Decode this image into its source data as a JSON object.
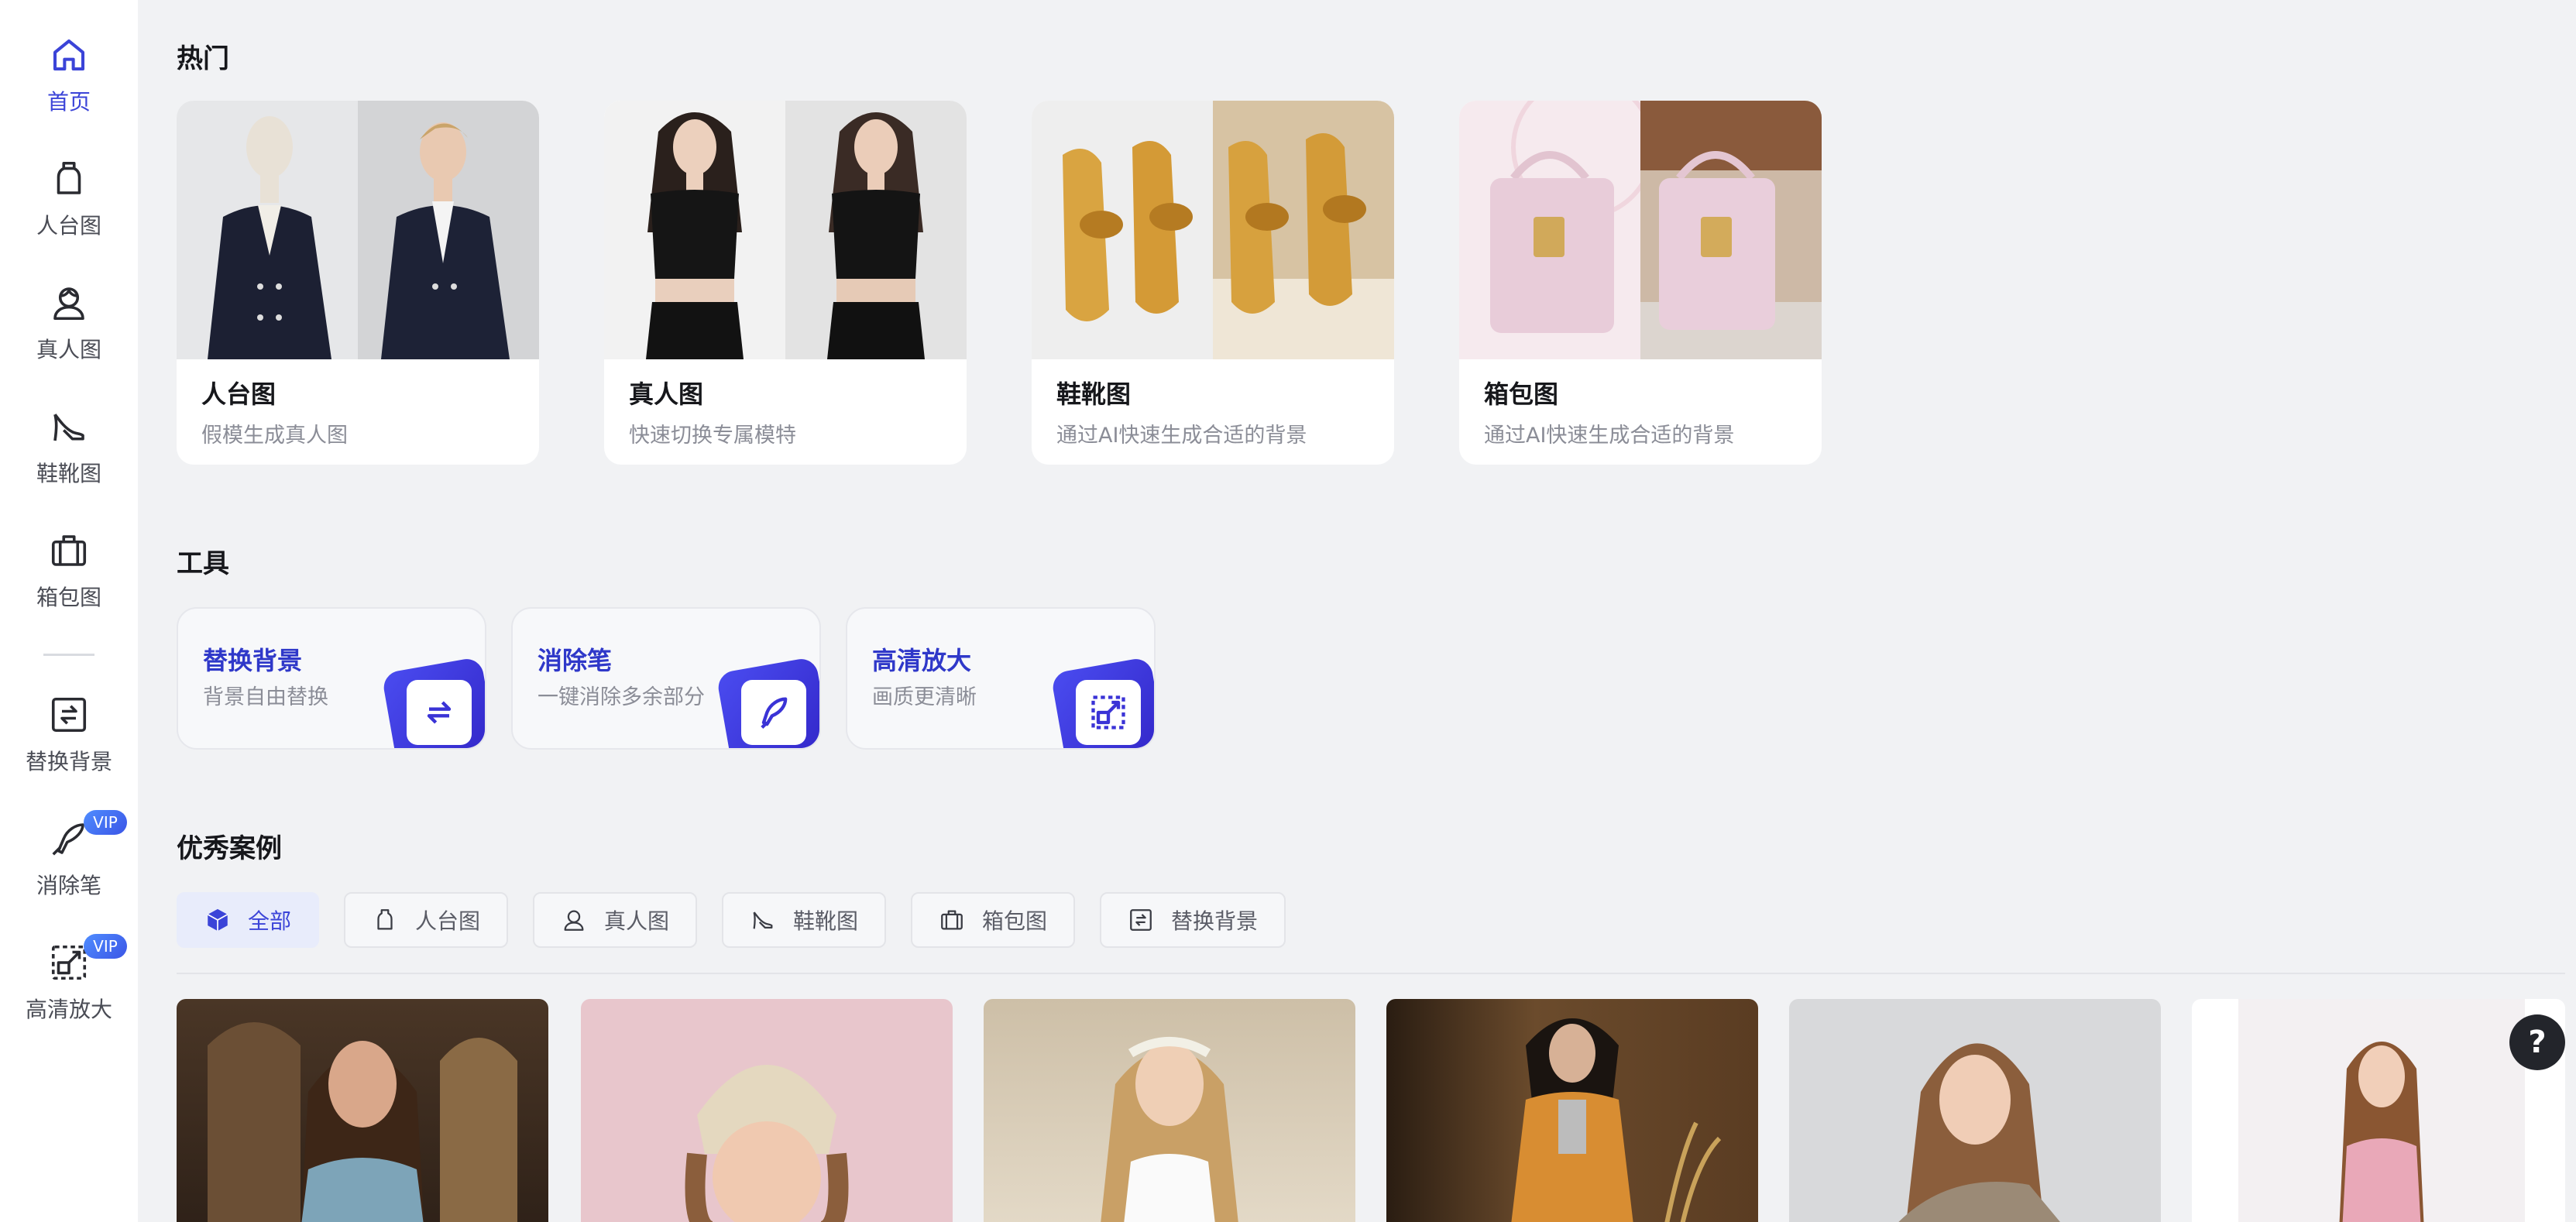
{
  "sidebar": {
    "items": [
      {
        "label": "首页",
        "icon": "home-icon"
      },
      {
        "label": "人台图",
        "icon": "mannequin-icon"
      },
      {
        "label": "真人图",
        "icon": "person-icon"
      },
      {
        "label": "鞋靴图",
        "icon": "high-heel-icon"
      },
      {
        "label": "箱包图",
        "icon": "bag-icon"
      },
      {
        "label": "替换背景",
        "icon": "replace-background-icon"
      },
      {
        "label": "消除笔",
        "icon": "eraser-pen-icon",
        "badge": "VIP"
      },
      {
        "label": "高清放大",
        "icon": "upscale-icon",
        "badge": "VIP"
      }
    ]
  },
  "hot": {
    "title": "热门",
    "cards": [
      {
        "title": "人台图",
        "desc": "假模生成真人图"
      },
      {
        "title": "真人图",
        "desc": "快速切换专属模特"
      },
      {
        "title": "鞋靴图",
        "desc": "通过AI快速生成合适的背景"
      },
      {
        "title": "箱包图",
        "desc": "通过AI快速生成合适的背景"
      }
    ]
  },
  "tools": {
    "title": "工具",
    "cards": [
      {
        "title": "替换背景",
        "desc": "背景自由替换",
        "icon": "replace-background-icon"
      },
      {
        "title": "消除笔",
        "desc": "一键消除多余部分",
        "icon": "eraser-pen-icon"
      },
      {
        "title": "高清放大",
        "desc": "画质更清晰",
        "icon": "upscale-icon"
      }
    ]
  },
  "cases": {
    "title": "优秀案例",
    "tabs": [
      {
        "label": "全部",
        "icon": "cube-icon",
        "active": true
      },
      {
        "label": "人台图",
        "icon": "mannequin-icon"
      },
      {
        "label": "真人图",
        "icon": "person-icon"
      },
      {
        "label": "鞋靴图",
        "icon": "high-heel-icon"
      },
      {
        "label": "箱包图",
        "icon": "bag-icon"
      },
      {
        "label": "替换背景",
        "icon": "replace-background-icon"
      }
    ]
  },
  "help": {
    "label": "?"
  },
  "colors": {
    "accent": "#3b44d8",
    "tile": "#3a33d6",
    "vip": "#4f8dff"
  }
}
